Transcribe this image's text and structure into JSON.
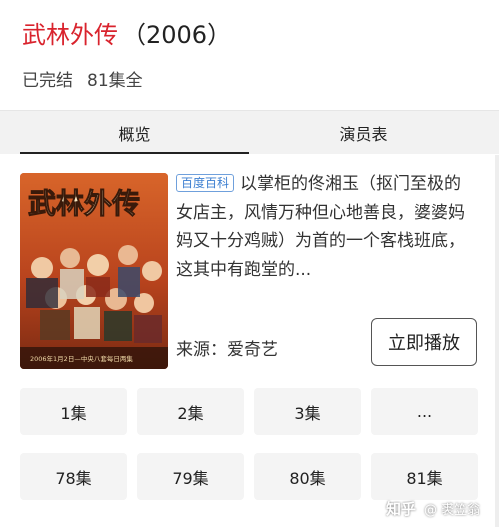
{
  "header": {
    "title": "武林外传",
    "year": "（2006）"
  },
  "meta": {
    "status": "已完结",
    "episodes": "81集全"
  },
  "tabs": [
    {
      "label": "概览"
    },
    {
      "label": "演员表"
    }
  ],
  "poster": {
    "title_art": "武林外传",
    "caption": "2006年1月2日—中央八套每日两集"
  },
  "summary": {
    "badge": "百度百科",
    "text": "以掌柜的佟湘玉（抠门至极的女店主，风情万种但心地善良，婆婆妈妈又十分鸡贼）为首的一个客栈班底，这其中有跑堂的..."
  },
  "source": {
    "label": "来源：爱奇艺"
  },
  "play_button": {
    "label": "立即播放"
  },
  "episodes": [
    "1集",
    "2集",
    "3集",
    "...",
    "78集",
    "79集",
    "80集",
    "81集"
  ],
  "watermark": {
    "logo": "知乎",
    "author": "@ 裘笠翁"
  },
  "colors": {
    "title_red": "#d9232d",
    "badge_blue": "#3d7fd1",
    "tab_bg": "#f2f2f2",
    "episode_bg": "#f4f4f4"
  }
}
